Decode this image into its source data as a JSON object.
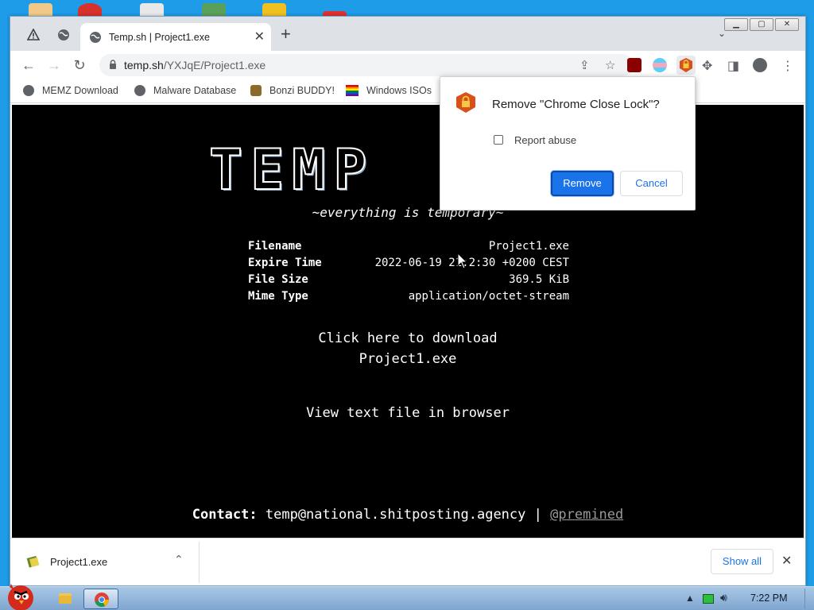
{
  "browser": {
    "tab_title": "Temp.sh | Project1.exe",
    "url_host": "temp.sh",
    "url_path": "/YXJqE/Project1.exe"
  },
  "bookmarks": [
    {
      "label": "MEMZ Download",
      "icon": "globe-icon"
    },
    {
      "label": "Malware Database",
      "icon": "globe-icon"
    },
    {
      "label": "Bonzi BUDDY!",
      "icon": "bonzi-icon"
    },
    {
      "label": "Windows ISOs",
      "icon": "windows-flag-icon"
    }
  ],
  "page": {
    "logo_text": "TEMP",
    "tagline": "~everything is temporary~",
    "info": [
      {
        "key": "Filename",
        "value": "Project1.exe"
      },
      {
        "key": "Expire Time",
        "value": "2022-06-19 21:2:30 +0200 CEST"
      },
      {
        "key": "File Size",
        "value": "369.5 KiB"
      },
      {
        "key": "Mime Type",
        "value": "application/octet-stream"
      }
    ],
    "download_line1": "Click here to download",
    "download_line2": "Project1.exe",
    "view_text": "View text file in browser",
    "contact_label": "Contact:",
    "contact_email": "temp@national.shitposting.agency",
    "contact_sep": "|",
    "contact_handle": "@premined"
  },
  "dialog": {
    "title": "Remove \"Chrome Close Lock\"?",
    "checkbox_label": "Report abuse",
    "checkbox_checked": false,
    "remove_label": "Remove",
    "cancel_label": "Cancel"
  },
  "download_shelf": {
    "file_name": "Project1.exe",
    "show_all_label": "Show all"
  },
  "taskbar": {
    "clock": "7:22 PM"
  },
  "colors": {
    "accent": "#1a73e8",
    "page_bg": "#000000",
    "desktop": "#1e9ce8"
  }
}
